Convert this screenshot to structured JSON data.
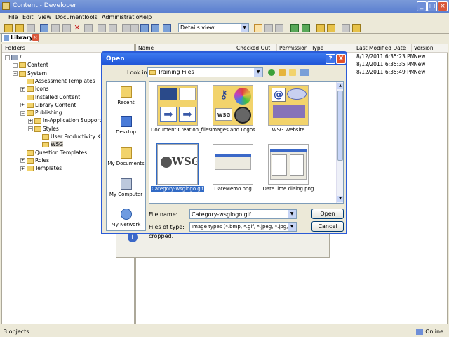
{
  "app": {
    "title": "Content - Developer",
    "menu": [
      "File",
      "Edit",
      "View",
      "Document",
      "Tools",
      "Administration",
      "Help"
    ],
    "view_select": "Details view",
    "tab_label": "Library"
  },
  "folders": {
    "header": "Folders",
    "items": [
      {
        "label": "/",
        "pm": "−"
      },
      {
        "label": "Content",
        "pm": "+"
      },
      {
        "label": "System",
        "pm": "−"
      },
      {
        "label": "Assessment Templates",
        "pm": ""
      },
      {
        "label": "Icons",
        "pm": "+"
      },
      {
        "label": "Installed Content",
        "pm": ""
      },
      {
        "label": "Library Content",
        "pm": "+"
      },
      {
        "label": "Publishing",
        "pm": "−"
      },
      {
        "label": "In-Application Support",
        "pm": "+"
      },
      {
        "label": "Styles",
        "pm": "−"
      },
      {
        "label": "User Productivity Kit",
        "pm": ""
      },
      {
        "label": "WSG",
        "pm": ""
      },
      {
        "label": "Question Templates",
        "pm": ""
      },
      {
        "label": "Roles",
        "pm": "+"
      },
      {
        "label": "Templates",
        "pm": "+"
      }
    ]
  },
  "list": {
    "columns": [
      "Name",
      "Checked Out By",
      "Permission",
      "Type",
      "Last Modified Date",
      "Version"
    ],
    "rows": [
      {
        "modified": "8/12/2011 6:35:23 PM",
        "version": "New"
      },
      {
        "modified": "8/12/2011 6:35:35 PM",
        "version": "New"
      },
      {
        "modified": "8/12/2011 6:35:49 PM",
        "version": "New"
      }
    ]
  },
  "bg_message": "cropped.",
  "status": {
    "left": "3 objects",
    "right": "Online"
  },
  "dialog": {
    "title": "Open",
    "help": "?",
    "close": "X",
    "lookin_label": "Look in:",
    "lookin_value": "Training Files",
    "places": [
      "Recent",
      "Desktop",
      "My Documents",
      "My Computer",
      "My Network"
    ],
    "files": [
      {
        "name": "Document Creation_files"
      },
      {
        "name": "Images and Logos"
      },
      {
        "name": "WSG Website"
      },
      {
        "name": "Category-wsglogo.gif"
      },
      {
        "name": "DateMemo.png"
      },
      {
        "name": "DateTime dialog.png"
      }
    ],
    "thumb_text": "WSG",
    "thumb_key_text": "WSG",
    "file_name_label": "File name:",
    "file_name_value": "Category-wsglogo.gif",
    "file_type_label": "Files of type:",
    "file_type_value": "Image types (*.bmp, *.gif, *.jpeg, *.jpg, *.png, *.t",
    "open_label": "Open",
    "cancel_label": "Cancel"
  }
}
